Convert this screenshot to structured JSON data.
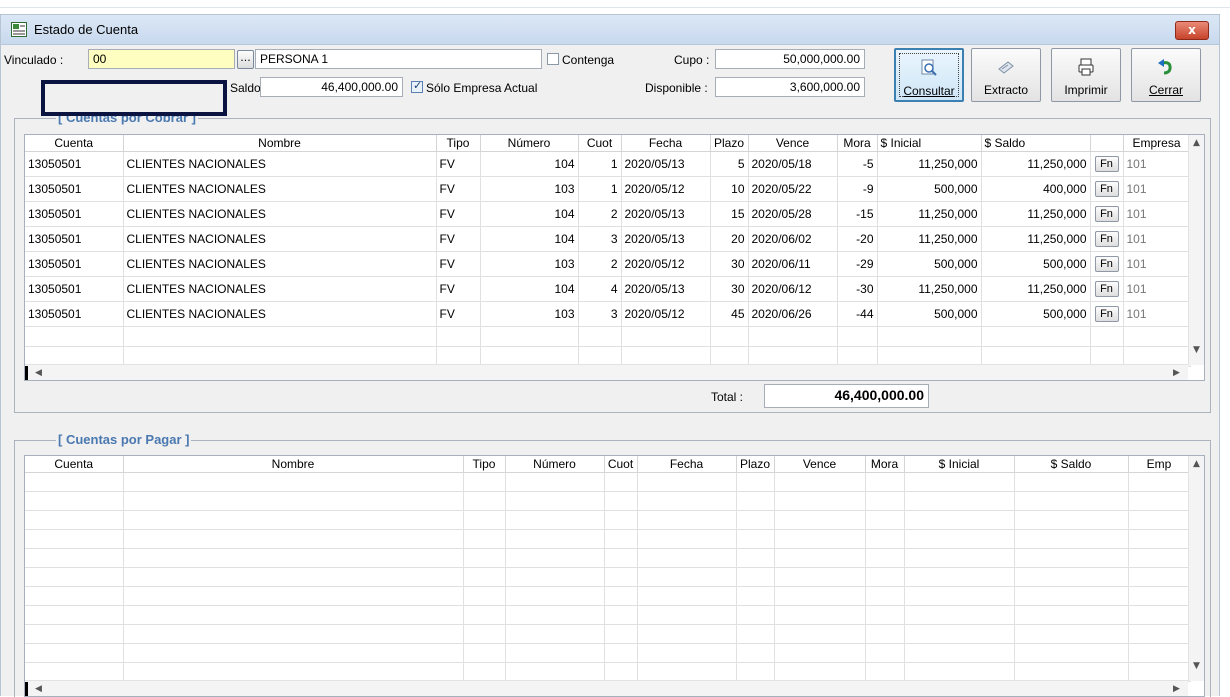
{
  "window": {
    "title": "Estado de Cuenta",
    "close_label": "x"
  },
  "header": {
    "vinculado_label": "Vinculado :",
    "vinculado_value": "00",
    "dots_label": "...",
    "persona_value": "PERSONA 1",
    "contenga_label": "Contenga",
    "contenga_checked": false,
    "cupo_label": "Cupo :",
    "cupo_value": "50,000,000.00",
    "saldo_label": "Saldo",
    "saldo_value": "46,400,000.00",
    "solo_empresa_label": "Sólo Empresa Actual",
    "solo_empresa_checked": true,
    "disponible_label": "Disponible :",
    "disponible_value": "3,600,000.00"
  },
  "toolbar": {
    "consultar": {
      "label": "Consultar",
      "icon": "magnifier-document-icon"
    },
    "extracto": {
      "label": "Extracto",
      "icon": "statement-icon"
    },
    "imprimir": {
      "label": "Imprimir",
      "icon": "printer-icon"
    },
    "cerrar": {
      "label": "Cerrar",
      "icon": "undo-arrow-icon"
    }
  },
  "cobrar": {
    "title": "[ Cuentas por Cobrar ]",
    "columns": [
      "Cuenta",
      "Nombre",
      "Tipo",
      "Número",
      "Cuot",
      "Fecha",
      "Plazo",
      "Vence",
      "Mora",
      "$ Inicial",
      "$ Saldo",
      "",
      "Empresa"
    ],
    "rows": [
      [
        "13050501",
        "CLIENTES NACIONALES",
        "FV",
        "104",
        "1",
        "2020/05/13",
        "5",
        "2020/05/18",
        "-5",
        "11,250,000",
        "11,250,000",
        "Fn",
        "101"
      ],
      [
        "13050501",
        "CLIENTES NACIONALES",
        "FV",
        "103",
        "1",
        "2020/05/12",
        "10",
        "2020/05/22",
        "-9",
        "500,000",
        "400,000",
        "Fn",
        "101"
      ],
      [
        "13050501",
        "CLIENTES NACIONALES",
        "FV",
        "104",
        "2",
        "2020/05/13",
        "15",
        "2020/05/28",
        "-15",
        "11,250,000",
        "11,250,000",
        "Fn",
        "101"
      ],
      [
        "13050501",
        "CLIENTES NACIONALES",
        "FV",
        "104",
        "3",
        "2020/05/13",
        "20",
        "2020/06/02",
        "-20",
        "11,250,000",
        "11,250,000",
        "Fn",
        "101"
      ],
      [
        "13050501",
        "CLIENTES NACIONALES",
        "FV",
        "103",
        "2",
        "2020/05/12",
        "30",
        "2020/06/11",
        "-29",
        "500,000",
        "500,000",
        "Fn",
        "101"
      ],
      [
        "13050501",
        "CLIENTES NACIONALES",
        "FV",
        "104",
        "4",
        "2020/05/13",
        "30",
        "2020/06/12",
        "-30",
        "11,250,000",
        "11,250,000",
        "Fn",
        "101"
      ],
      [
        "13050501",
        "CLIENTES NACIONALES",
        "FV",
        "103",
        "3",
        "2020/05/12",
        "45",
        "2020/06/26",
        "-44",
        "500,000",
        "500,000",
        "Fn",
        "101"
      ]
    ],
    "total_label": "Total :",
    "total_value": "46,400,000.00"
  },
  "pagar": {
    "title": "[ Cuentas por Pagar ]",
    "columns": [
      "Cuenta",
      "Nombre",
      "Tipo",
      "Número",
      "Cuot",
      "Fecha",
      "Plazo",
      "Vence",
      "Mora",
      "$ Inicial",
      "$ Saldo",
      "Emp"
    ]
  }
}
